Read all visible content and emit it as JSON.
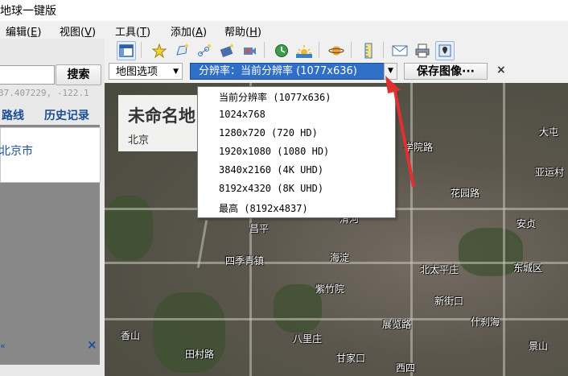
{
  "app": {
    "title": "地球一键版"
  },
  "menu": [
    {
      "label": "编辑",
      "key": "E"
    },
    {
      "label": "视图",
      "key": "V"
    },
    {
      "label": "工具",
      "key": "T"
    },
    {
      "label": "添加",
      "key": "A"
    },
    {
      "label": "帮助",
      "key": "H"
    }
  ],
  "left_panel": {
    "search_button": "搜索",
    "search_value": "",
    "coords": "37.407229, -122.1",
    "route_tab": "路线",
    "history_tab": "历史记录",
    "result_item": "北京市",
    "scroll_glyph": "«",
    "close_glyph": "×"
  },
  "toolbar": {
    "icons": [
      "sidebar-toggle-icon",
      "add-placemark-icon",
      "add-polygon-icon",
      "add-path-icon",
      "add-overlay-icon",
      "record-tour-icon",
      "historical-imagery-icon",
      "sunlight-icon",
      "planets-icon",
      "ruler-icon",
      "email-icon",
      "print-icon",
      "save-image-icon"
    ]
  },
  "options_bar": {
    "map_options": "地图选项",
    "resolution_label": "分辨率：当前分辨率 (1077x636)",
    "save_image": "保存图像···",
    "close": "×"
  },
  "resolution_options": [
    "当前分辨率 (1077x636)",
    "1024x768",
    "1280x720 (720 HD)",
    "1920x1080 (1080 HD)",
    "3840x2160 (4K UHD)",
    "8192x4320 (8K UHD)",
    "最高 (8192x4837)"
  ],
  "map": {
    "title": "未命名地",
    "subtitle": "北京",
    "labels": [
      "学院路",
      "花园路",
      "大屯",
      "亚运村",
      "安贞",
      "东城区",
      "北太平庄",
      "新街口",
      "什刹海",
      "西四",
      "景山",
      "香山",
      "四季青镇",
      "海淀",
      "紫竹院",
      "展览路",
      "八里庄",
      "甘家口",
      "田村路",
      "昌平",
      "清河"
    ]
  },
  "colors": {
    "accent": "#2f6fc7",
    "link": "#1a4d96",
    "arrow": "#e03030"
  }
}
